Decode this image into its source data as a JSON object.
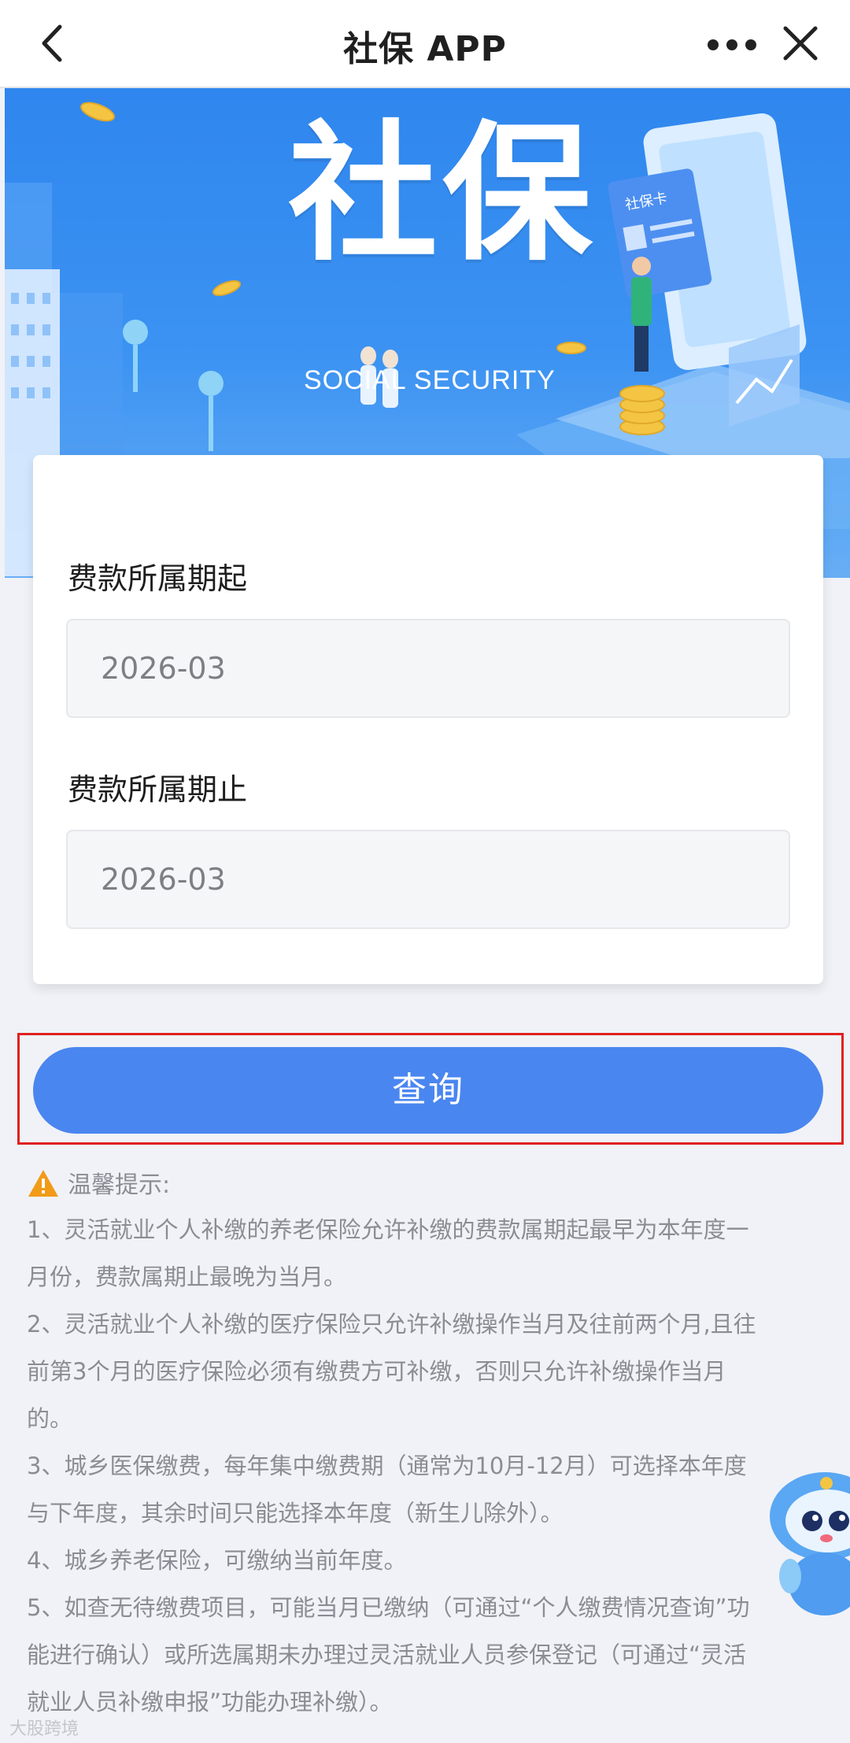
{
  "navbar": {
    "title": "社保 APP",
    "back_icon": "chevron-left-icon",
    "more_icon": "more-dots-icon",
    "close_icon": "close-icon"
  },
  "banner": {
    "title": "社保",
    "subtitle": "SOCIAL SECURITY",
    "card_label": "社保卡"
  },
  "form": {
    "start_label": "费款所属期起",
    "start_value": "2026-03",
    "end_label": "费款所属期止",
    "end_value": "2026-03"
  },
  "query_button": {
    "label": "查询",
    "color": "#4a86f0"
  },
  "highlight_color": "#e02020",
  "tips": {
    "title": "温馨提示:",
    "lines": [
      "1、灵活就业个人补缴的养老保险允许补缴的费款属期起最早为本年度一",
      "月份，费款属期止最晚为当月。",
      "2、灵活就业个人补缴的医疗保险只允许补缴操作当月及往前两个月,且往",
      "前第3个月的医疗保险必须有缴费方可补缴，否则只允许补缴操作当月",
      "的。",
      "3、城乡医保缴费，每年集中缴费期（通常为10月-12月）可选择本年度",
      "与下年度，其余时间只能选择本年度（新生儿除外）。",
      "4、城乡养老保险，可缴纳当前年度。",
      "5、如查无待缴费项目，可能当月已缴纳（可通过“个人缴费情况查询”功",
      "能进行确认）或所选属期未办理过灵活就业人员参保登记（可通过“灵活",
      "就业人员补缴申报”功能办理补缴）。"
    ]
  },
  "watermark": "大股跨境"
}
